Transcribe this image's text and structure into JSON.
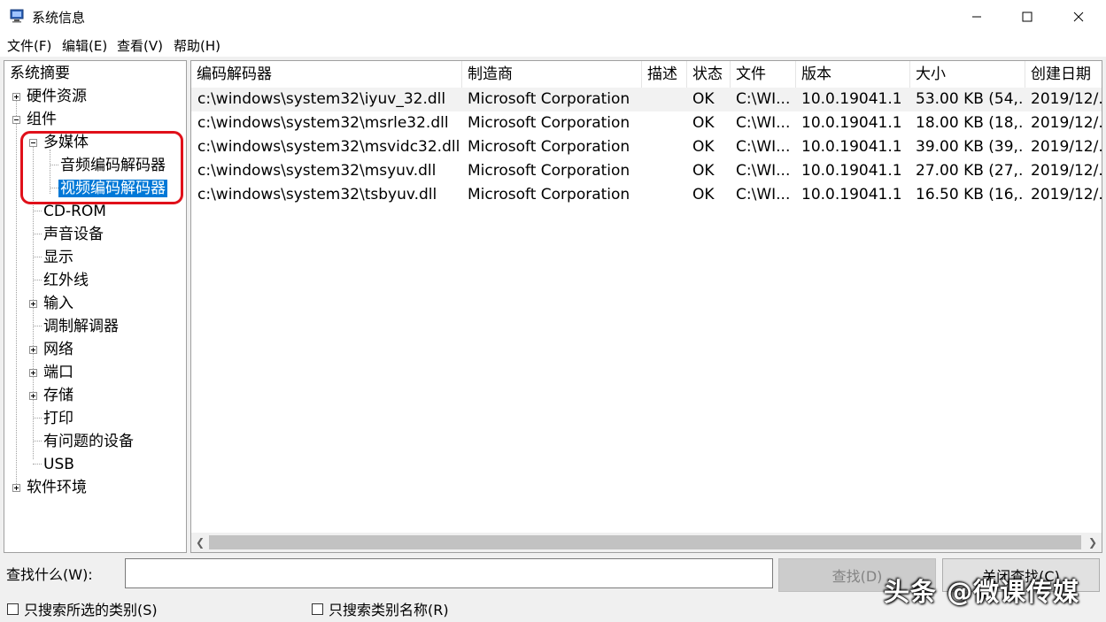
{
  "window": {
    "title": "系统信息",
    "icon": "system-info-monitor-icon"
  },
  "menu": [
    {
      "label": "文件(F)"
    },
    {
      "label": "编辑(E)"
    },
    {
      "label": "查看(V)"
    },
    {
      "label": "帮助(H)"
    }
  ],
  "tree": {
    "nodes": [
      {
        "label": "系统摘要"
      },
      {
        "label": "硬件资源"
      },
      {
        "label": "组件"
      },
      {
        "label": "多媒体"
      },
      {
        "label": "音频编码解码器"
      },
      {
        "label": "视频编码解码器"
      },
      {
        "label": "CD-ROM"
      },
      {
        "label": "声音设备"
      },
      {
        "label": "显示"
      },
      {
        "label": "红外线"
      },
      {
        "label": "输入"
      },
      {
        "label": "调制解调器"
      },
      {
        "label": "网络"
      },
      {
        "label": "端口"
      },
      {
        "label": "存储"
      },
      {
        "label": "打印"
      },
      {
        "label": "有问题的设备"
      },
      {
        "label": "USB"
      },
      {
        "label": "软件环境"
      }
    ],
    "selected": "视频编码解码器",
    "highlight_color": "#e0101a"
  },
  "table": {
    "columns": [
      "编码解码器",
      "制造商",
      "描述",
      "状态",
      "文件",
      "版本",
      "大小",
      "创建日期"
    ],
    "rows": [
      [
        "c:\\windows\\system32\\iyuv_32.dll",
        "Microsoft Corporation",
        "",
        "OK",
        "C:\\WI...",
        "10.0.19041.1",
        "53.00 KB (54,...",
        "2019/12/..."
      ],
      [
        "c:\\windows\\system32\\msrle32.dll",
        "Microsoft Corporation",
        "",
        "OK",
        "C:\\WI...",
        "10.0.19041.1",
        "18.00 KB (18,...",
        "2019/12/..."
      ],
      [
        "c:\\windows\\system32\\msvidc32.dll",
        "Microsoft Corporation",
        "",
        "OK",
        "C:\\WI...",
        "10.0.19041.1",
        "39.00 KB (39,...",
        "2019/12/..."
      ],
      [
        "c:\\windows\\system32\\msyuv.dll",
        "Microsoft Corporation",
        "",
        "OK",
        "C:\\WI...",
        "10.0.19041.1",
        "27.00 KB (27,...",
        "2019/12/..."
      ],
      [
        "c:\\windows\\system32\\tsbyuv.dll",
        "Microsoft Corporation",
        "",
        "OK",
        "C:\\WI...",
        "10.0.19041.1",
        "16.50 KB (16,...",
        "2019/12/..."
      ]
    ]
  },
  "search": {
    "label": "查找什么(W):",
    "value": "",
    "find_button": "查找(D)",
    "close_find_button": "关闭查找(C)",
    "checkbox_selected_category": "只搜索所选的类别(S)",
    "checkbox_category_names": "只搜索类别名称(R)"
  },
  "watermark": "头条 @微课传媒",
  "colors": {
    "selection": "#0078d7",
    "highlight": "#e0101a"
  }
}
